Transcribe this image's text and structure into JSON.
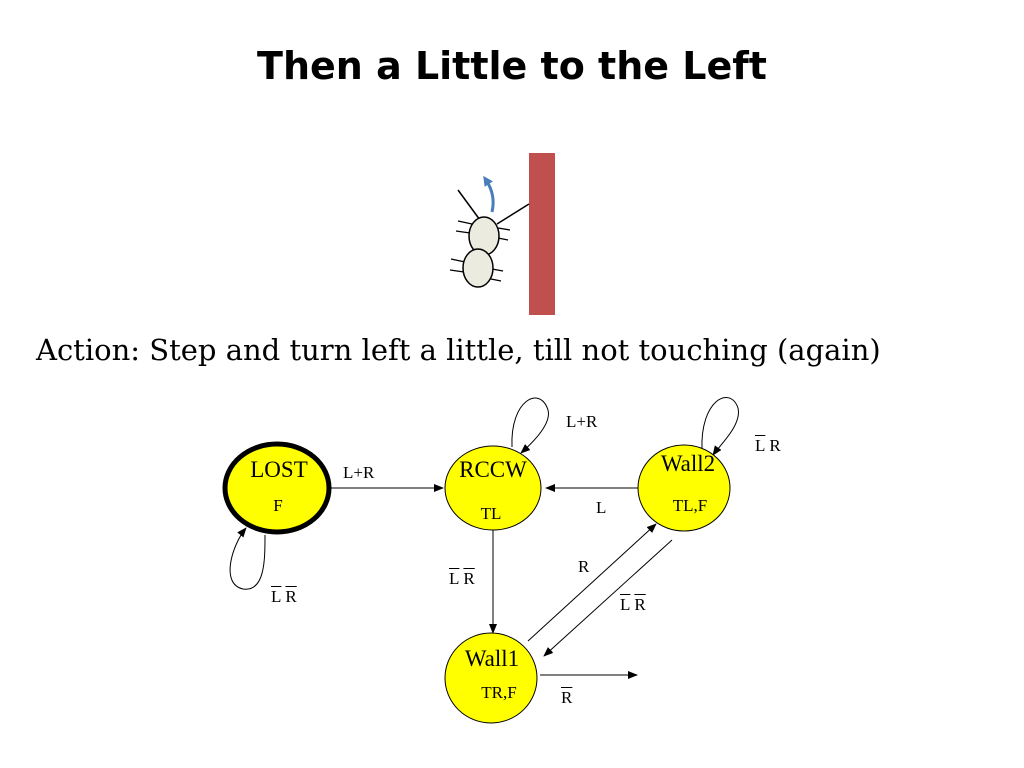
{
  "title": "Then a Little to the Left",
  "action_text": "Action: Step and turn left a little, till not touching (again)",
  "colors": {
    "state_fill": "#ffff00",
    "wall": "#c0504d",
    "arrow_turn": "#4a7ebb",
    "robot_body": "#ebebe0"
  },
  "states": {
    "lost": {
      "name": "LOST",
      "output": "F",
      "initial": true
    },
    "rccw": {
      "name": "RCCW",
      "output": "TL"
    },
    "wall2": {
      "name": "Wall2",
      "output": "TL,F"
    },
    "wall1": {
      "name": "Wall1",
      "output": "TR,F"
    }
  },
  "transitions": {
    "lost_to_rccw": {
      "a": "L+R"
    },
    "rccw_self": {
      "a": "L+R"
    },
    "wall2_self": {
      "a": "L",
      "b": "R",
      "a_bar": true,
      "b_bar": false
    },
    "wall2_to_rccw": {
      "a": "L"
    },
    "lost_self": {
      "a": "L",
      "b": "R",
      "a_bar": true,
      "b_bar": true
    },
    "rccw_to_wall1": {
      "a": "L",
      "b": "R",
      "a_bar": true,
      "b_bar": true
    },
    "wall1_to_wall2": {
      "a": "R"
    },
    "wall2_to_wall1": {
      "a": "L",
      "b": "R",
      "a_bar": true,
      "b_bar": true
    },
    "wall1_exit": {
      "a": "R",
      "a_bar": true
    }
  }
}
